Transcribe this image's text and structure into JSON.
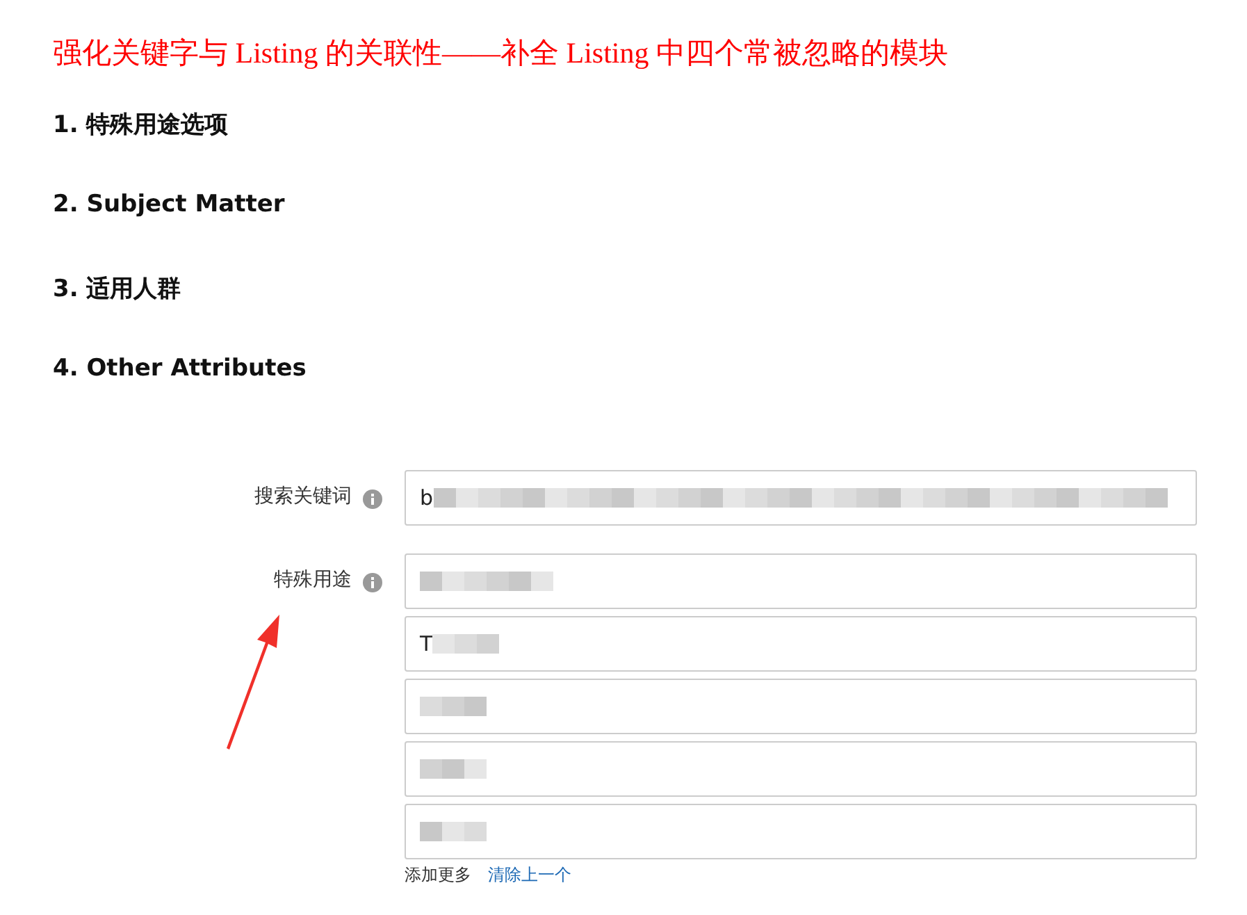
{
  "title": "强化关键字与 Listing 的关联性——补全 Listing 中四个常被忽略的模块",
  "items": [
    "1.  特殊用途选项",
    "2. Subject Matter",
    "3.  适用人群",
    "4. Other Attributes"
  ],
  "form": {
    "rows": [
      {
        "label": "搜索关键词",
        "fields": [
          {
            "value": "b",
            "blurred": true
          }
        ]
      },
      {
        "label": "特殊用途",
        "fields": [
          {
            "blurred": true
          },
          {
            "value": "T",
            "blurred": true
          },
          {
            "blurred": true
          },
          {
            "blurred": true
          },
          {
            "blurred": true
          }
        ]
      }
    ],
    "add_more": "添加更多",
    "remove_last": "清除上一个"
  }
}
